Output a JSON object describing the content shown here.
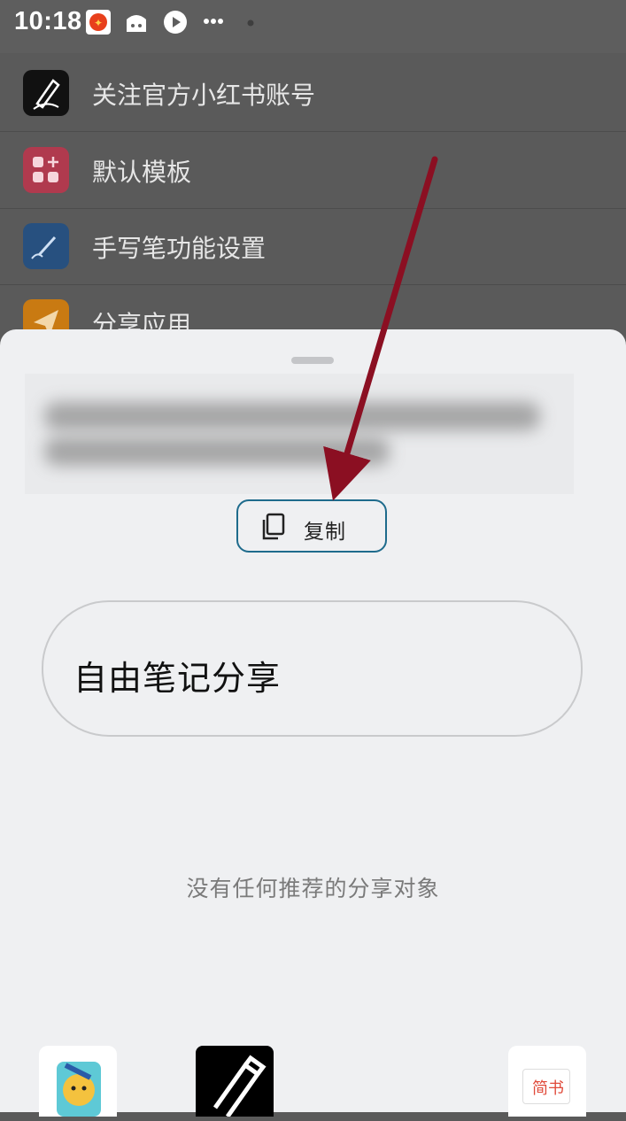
{
  "status_bar": {
    "time": "10:18"
  },
  "menu": {
    "items": [
      {
        "label": "关注官方小红书账号",
        "icon": "pen-icon",
        "color": "#111111"
      },
      {
        "label": "默认模板",
        "icon": "grid-plus-icon",
        "color": "#b03a4e"
      },
      {
        "label": "手写笔功能设置",
        "icon": "stylus-icon",
        "color": "#27507f"
      },
      {
        "label": "分享应用",
        "icon": "send-icon",
        "color": "#c97a12"
      }
    ]
  },
  "share_sheet": {
    "copy_label": "复制",
    "note_title": "自由笔记分享",
    "empty_message": "没有任何推荐的分享对象",
    "apps": [
      {
        "name": "shiba-app-icon"
      },
      {
        "name": "pencil-app-icon"
      },
      {
        "name": "jianshu-app-icon",
        "label": "简书"
      }
    ]
  },
  "colors": {
    "accent": "#1e6b8c",
    "arrow": "#8b0f22"
  }
}
